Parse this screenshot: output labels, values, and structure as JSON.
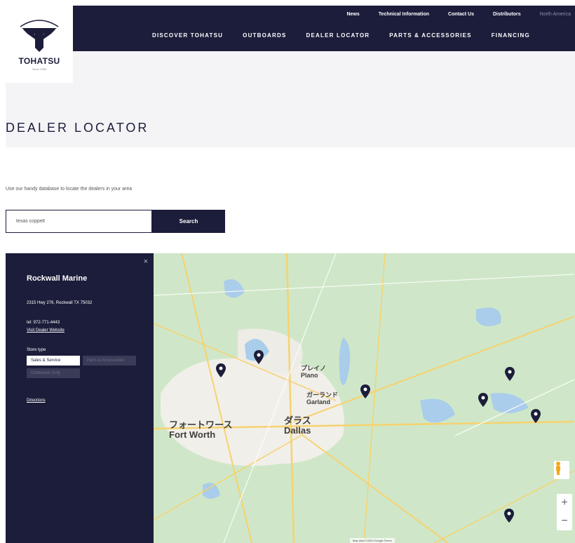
{
  "brand": {
    "name": "TOHATSU",
    "tagline": "Since 1956",
    "color_primary": "#1b1d3a"
  },
  "util_nav": {
    "items": [
      "News",
      "Technical Information",
      "Contact Us",
      "Distributors"
    ],
    "region": "North America"
  },
  "main_nav": {
    "items": [
      "DISCOVER TOHATSU",
      "OUTBOARDS",
      "DEALER LOCATOR",
      "PARTS & ACCESSORIES",
      "FINANCING"
    ]
  },
  "page": {
    "title": "DEALER LOCATOR",
    "intro": "Use our handy database to locate the dealers in your area"
  },
  "search": {
    "value": "texas coppell",
    "button_label": "Search"
  },
  "dealer_panel": {
    "close_label": "×",
    "name": "Rockwall Marine",
    "address": "2315 Hwy 276, Rockwall TX 75032",
    "tel": "tel: 972-771-4443",
    "website_label": "Visit Dealer Website",
    "store_type_label": "Store type",
    "store_types": [
      {
        "label": "Sales & Service",
        "active": true
      },
      {
        "label": "Parts & Accessories",
        "active": false
      },
      {
        "label": "Outboards Only",
        "active": false
      }
    ],
    "directions_label": "Directions"
  },
  "map": {
    "cities": [
      {
        "jp": "フォートワース",
        "en": "Fort Worth"
      },
      {
        "jp": "ダラス",
        "en": "Dallas"
      },
      {
        "jp": "プレイノ",
        "en": "Plano"
      },
      {
        "jp": "ガーランド",
        "en": "Garland"
      }
    ],
    "zoom_in": "+",
    "zoom_out": "−",
    "footer": "Map data ©2023 Google  Terms"
  }
}
